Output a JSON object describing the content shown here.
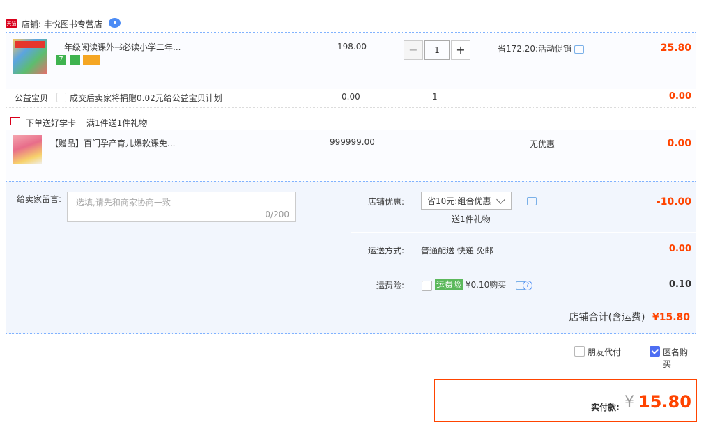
{
  "shop": {
    "tmall_label": "天猫",
    "name": "店铺: 丰悦图书专营店"
  },
  "item1": {
    "title": "一年级阅读课外书必读小学二年...",
    "badges": [
      "7",
      "",
      ""
    ],
    "price": "198.00",
    "qty": "1",
    "qty_minus": "−",
    "qty_plus": "+",
    "promo": "省172.20:活动促销",
    "amount": "25.80"
  },
  "charity": {
    "label": "公益宝贝",
    "text": "成交后卖家将捐赠0.02元给公益宝贝计划",
    "price": "0.00",
    "qty": "1",
    "amount": "0.00"
  },
  "gift_promo": {
    "label": "下单送好学卡",
    "text": "满1件送1件礼物"
  },
  "item2": {
    "title": "【赠品】百门孕产育儿爆款课免...",
    "price": "999999.00",
    "promo": "无优惠",
    "amount": "0.00"
  },
  "message": {
    "label": "给卖家留言:",
    "placeholder": "选填,请先和商家协商一致",
    "count": "0/200"
  },
  "shop_discount": {
    "label": "店铺优惠:",
    "selected": "省10元:组合优惠",
    "gift": "送1件礼物",
    "amount": "-10.00"
  },
  "shipping": {
    "label": "运送方式:",
    "text": "普通配送 快递 免邮",
    "amount": "0.00"
  },
  "insurance": {
    "label": "运费险:",
    "tag": "运费险",
    "text": "¥0.10购买",
    "amount": "0.10"
  },
  "shop_total": {
    "label": "店铺合计(含运费)",
    "amount": "¥15.80"
  },
  "options": {
    "friend_pay": "朋友代付",
    "anonymous": "匿名购买"
  },
  "payment": {
    "label": "实付款:",
    "currency": "¥",
    "amount": "15.80"
  },
  "colors": {
    "accent": "#ff4400",
    "link_blue": "#4c8cf5",
    "checkbox_blue": "#4e6ef2",
    "insurance_green": "#5cb85c"
  }
}
